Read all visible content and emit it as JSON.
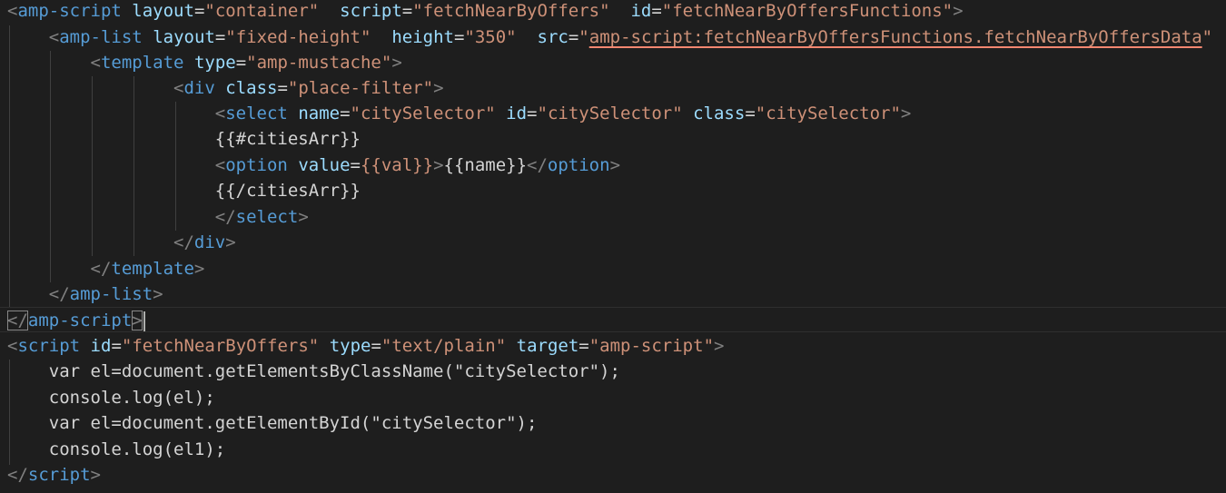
{
  "editor": {
    "lines": [
      {
        "tag_open": "<",
        "tag": "amp-script",
        "attr1": "layout",
        "val1": "\"container\"",
        "attr2": "script",
        "val2": "\"fetchNearByOffers\"",
        "attr3": "id",
        "val3": "\"fetchNearByOffersFunctions\"",
        "close": ">"
      },
      {
        "tag_open": "<",
        "tag": "amp-list",
        "attr1": "layout",
        "val1": "\"fixed-height\"",
        "attr2": "height",
        "val2": "\"350\"",
        "attr3": "src",
        "val3_q": "\"",
        "val3": "amp-script:fetchNearByOffersFunctions.fetchNearByOffersData",
        "val3_end": "\""
      },
      {
        "tag_open": "<",
        "tag": "template",
        "attr1": "type",
        "val1": "\"amp-mustache\"",
        "close": ">"
      },
      {
        "tag_open": "<",
        "tag": "div",
        "attr1": "class",
        "val1": "\"place-filter\"",
        "close": ">"
      },
      {
        "tag_open": "<",
        "tag": "select",
        "attr1": "name",
        "val1": "\"citySelector\"",
        "attr2": "id",
        "val2": "\"citySelector\"",
        "attr3": "class",
        "val3": "\"citySelector\"",
        "close": ">"
      },
      {
        "text": "{{#citiesArr}}"
      },
      {
        "tag_open": "<",
        "tag": "option",
        "attr1": "value",
        "val1": "{{val}}",
        "close": ">",
        "text": "{{name}}",
        "end_open": "</",
        "end_tag": "option",
        "end_close": ">"
      },
      {
        "text": "{{/citiesArr}}"
      },
      {
        "end_open": "</",
        "end_tag": "select",
        "end_close": ">"
      },
      {
        "end_open": "</",
        "end_tag": "div",
        "end_close": ">"
      },
      {
        "end_open": "</",
        "end_tag": "template",
        "end_close": ">"
      },
      {
        "end_open": "</",
        "end_tag": "amp-list",
        "end_close": ">"
      },
      {
        "end_open": "</",
        "end_tag": "amp-script",
        "end_close": ">"
      },
      {
        "tag_open": "<",
        "tag": "script",
        "attr1": "id",
        "val1": "\"fetchNearByOffers\"",
        "attr2": "type",
        "val2": "\"text/plain\"",
        "attr3": "target",
        "val3": "\"amp-script\"",
        "close": ">"
      },
      {
        "text": "var el=document.getElementsByClassName(\"citySelector\");"
      },
      {
        "text": "console.log(el);"
      },
      {
        "text": "var el=document.getElementById(\"citySelector\");"
      },
      {
        "text": "console.log(el1);"
      },
      {
        "end_open": "</",
        "end_tag": "script",
        "end_close": ">"
      }
    ]
  },
  "colors": {
    "background": "#1e1e1e",
    "tag": "#569cd6",
    "attribute": "#9cdcfe",
    "string": "#ce9178",
    "punctuation": "#808080",
    "text": "#d4d4d4",
    "link_underline": "#f48771"
  }
}
